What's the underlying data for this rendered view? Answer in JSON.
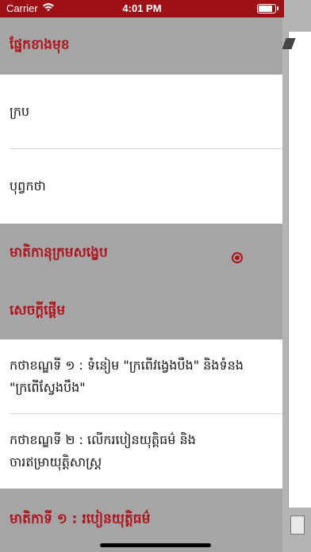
{
  "status_bar": {
    "carrier": "Carrier",
    "time": "4:01 PM"
  },
  "drawer": {
    "sections": [
      {
        "title": "ផ្នែកខាងមុខ",
        "items": [
          "ក្រប",
          "បុព្វកថា"
        ]
      },
      {
        "title": "មាតិកានុក្រមសង្ខេប",
        "items": []
      },
      {
        "title": "សេចក្ដីផ្ដើម",
        "items": [
          "កថាខណ្ឌទី ១ : ទំនៀម \"ក្រពើវង្វេងបឹង\" និងទំនង \"ក្រពើស្វែងបឹង\"",
          "កថាខណ្ឌទី ២ : លើករបៀនយុត្តិធម៌ និង ចារឥម្រាយុត្តិសាស្ត្រ"
        ]
      },
      {
        "title": "មាតិកាទី ១ : របៀនយុត្តិធម៌",
        "items": []
      }
    ]
  }
}
